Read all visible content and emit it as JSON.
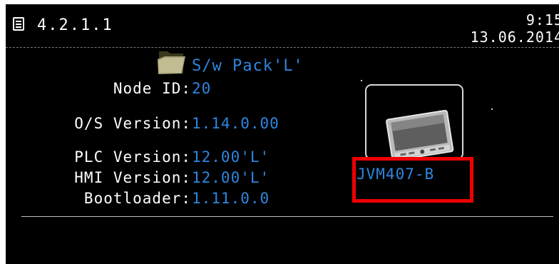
{
  "header": {
    "title": "4.2.1.1",
    "time": "9:15",
    "date": "13.06.2014",
    "menu_icon": "menu-list-icon"
  },
  "software_pack": {
    "icon": "folder-icon",
    "name": "S/w Pack'L'"
  },
  "info": [
    {
      "label": "Node ID:",
      "value": "20"
    },
    {
      "label": "O/S Version:",
      "value": "1.14.0.00"
    },
    {
      "label": "PLC Version:",
      "value": "12.00'L'"
    },
    {
      "label": "HMI Version:",
      "value": "12.00'L'"
    },
    {
      "label": "Bootloader:",
      "value": "1.11.0.0"
    }
  ],
  "device": {
    "icon": "hmi-device-icon",
    "model": "JVM407-B"
  },
  "colors": {
    "background": "#000000",
    "text": "#ffffff",
    "value": "#2e86df",
    "highlight": "#ee0000"
  }
}
